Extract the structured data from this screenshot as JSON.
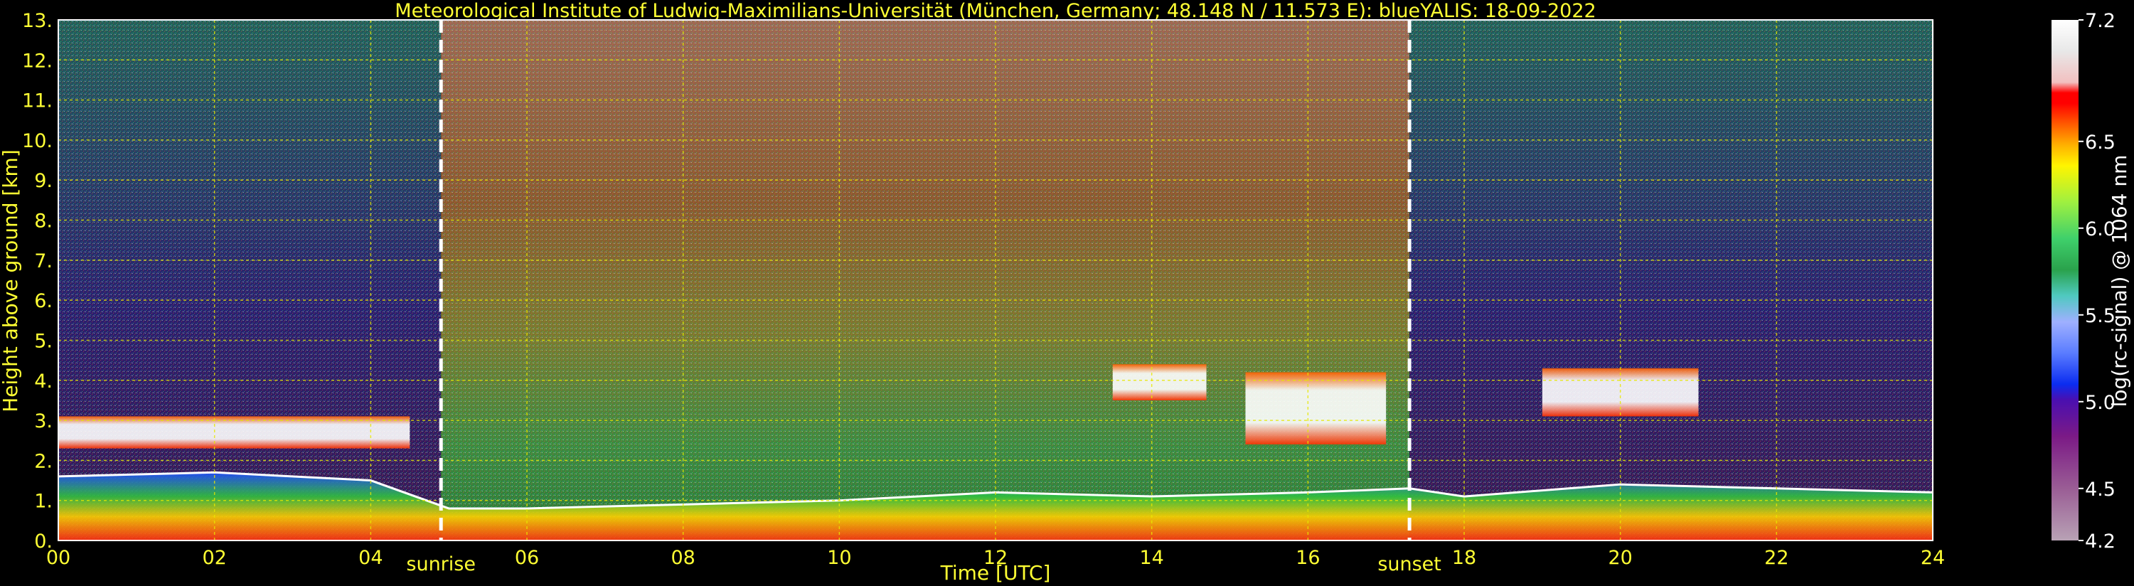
{
  "chart_data": {
    "type": "heatmap",
    "title": "Meteorological Institute of Ludwig-Maximilians-Universität (München, Germany; 48.148 N / 11.573 E):     blueYALIS: 18-09-2022",
    "xlabel": "Time [UTC]",
    "ylabel": "Height above ground [km]",
    "xlim": [
      0,
      24
    ],
    "ylim": [
      0,
      13
    ],
    "x_ticks": [
      "00",
      "02",
      "04",
      "06",
      "08",
      "10",
      "12",
      "14",
      "16",
      "18",
      "20",
      "22",
      "24"
    ],
    "y_ticks": [
      "0.",
      "1.",
      "2.",
      "3.",
      "4.",
      "5.",
      "6.",
      "7.",
      "8.",
      "9.",
      "10.",
      "11.",
      "12.",
      "13."
    ],
    "grid": true,
    "markers": [
      {
        "label": "sunrise",
        "x": 4.9
      },
      {
        "label": "sunset",
        "x": 17.3
      }
    ],
    "colorbar": {
      "label": "log(rc-signal) @ 1064 nm",
      "range": [
        4.2,
        7.2
      ],
      "ticks": [
        "7.2",
        "6.5",
        "6.0",
        "5.5",
        "5.0",
        "4.5",
        "4.2"
      ],
      "tick_values": [
        7.2,
        6.5,
        6.0,
        5.5,
        5.0,
        4.5,
        4.2
      ]
    },
    "features": {
      "cloud_layers": [
        {
          "t0": 0.0,
          "t1": 4.5,
          "h0": 2.3,
          "h1": 3.1
        },
        {
          "t0": 13.5,
          "t1": 14.7,
          "h0": 3.5,
          "h1": 4.4
        },
        {
          "t0": 15.2,
          "t1": 17.0,
          "h0": 2.4,
          "h1": 4.2
        },
        {
          "t0": 19.0,
          "t1": 21.0,
          "h0": 3.1,
          "h1": 4.3
        }
      ],
      "boundary_layer_top": [
        [
          0,
          1.6
        ],
        [
          2,
          1.7
        ],
        [
          4,
          1.5
        ],
        [
          5,
          0.8
        ],
        [
          6,
          0.8
        ],
        [
          8,
          0.9
        ],
        [
          10,
          1.0
        ],
        [
          12,
          1.2
        ],
        [
          14,
          1.1
        ],
        [
          16,
          1.2
        ],
        [
          17.3,
          1.3
        ],
        [
          18,
          1.1
        ],
        [
          20,
          1.4
        ],
        [
          22,
          1.3
        ],
        [
          24,
          1.2
        ]
      ]
    }
  }
}
